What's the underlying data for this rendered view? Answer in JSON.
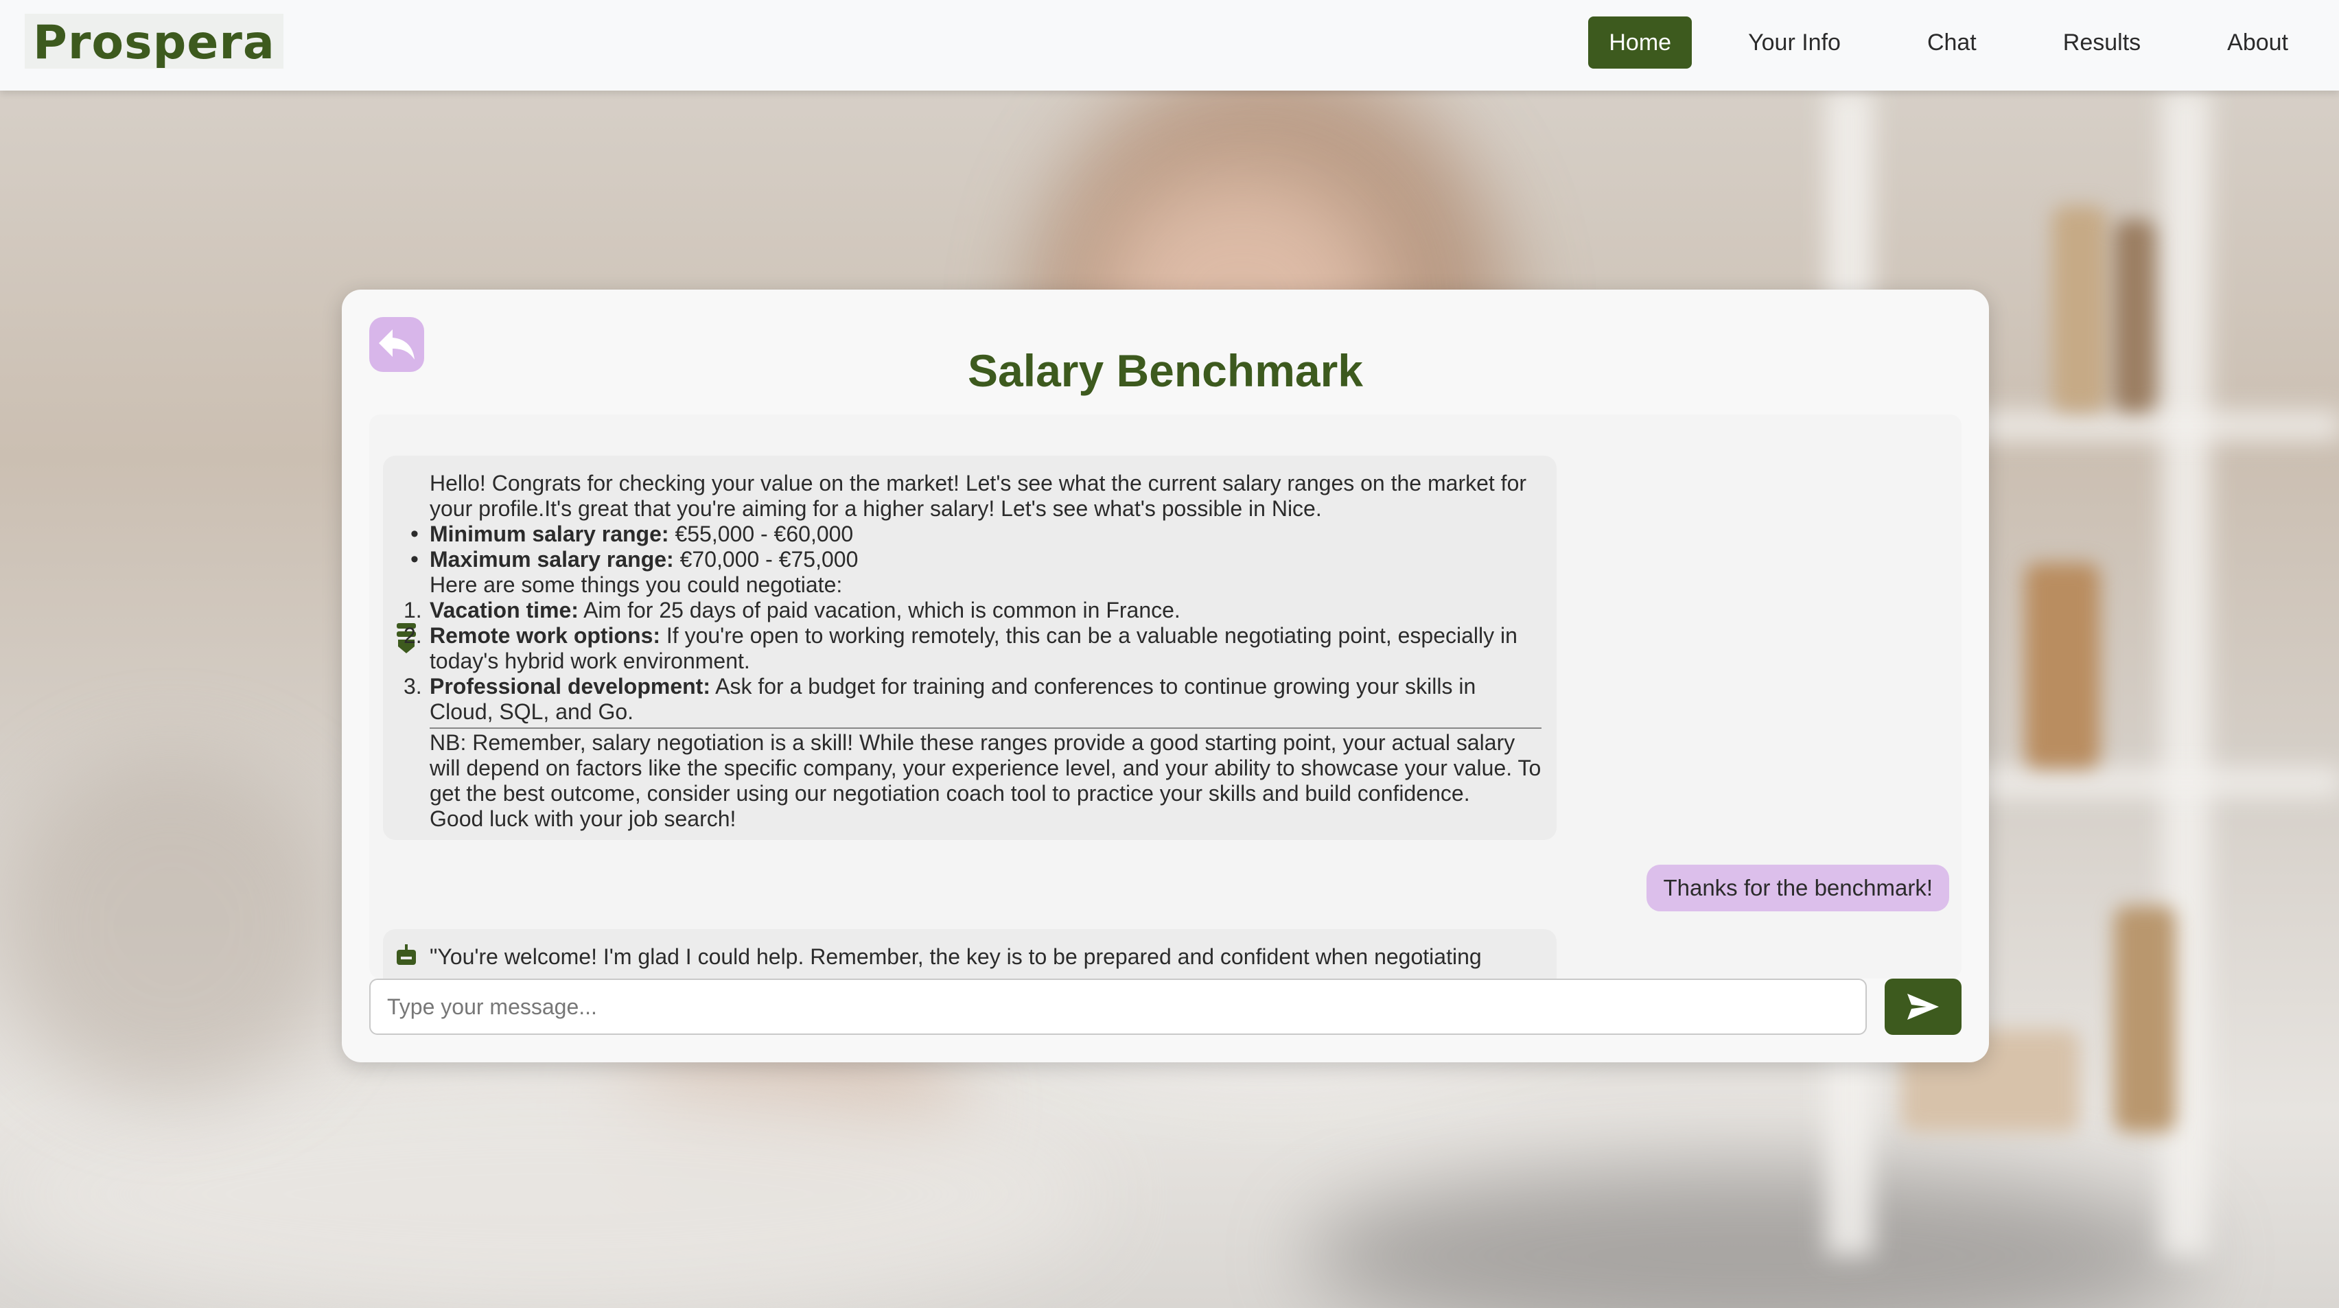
{
  "app": {
    "logo": "Prospera",
    "accent_color": "#3d5a1e",
    "secondary_color": "#dcbfeb"
  },
  "nav": {
    "items": [
      {
        "label": "Home",
        "active": true
      },
      {
        "label": "Your Info",
        "active": false
      },
      {
        "label": "Chat",
        "active": false
      },
      {
        "label": "Results",
        "active": false
      },
      {
        "label": "About",
        "active": false
      }
    ]
  },
  "card": {
    "title": "Salary Benchmark",
    "back_icon": "reply-arrow-icon"
  },
  "messages": {
    "bot1": {
      "intro": "Hello! Congrats for checking your value on the market! Let's see what the current salary ranges on the market for your profile.It's great that you're aiming for a higher salary! Let's see what's possible in Nice.",
      "bullets": [
        {
          "label": "Minimum salary range:",
          "value": " €55,000 - €60,000"
        },
        {
          "label": "Maximum salary range:",
          "value": " €70,000 - €75,000"
        }
      ],
      "negotiate_intro": "Here are some things you could negotiate:",
      "items": [
        {
          "num": "1.",
          "label": "Vacation time:",
          "text": " Aim for 25 days of paid vacation, which is common in France."
        },
        {
          "num": "2.",
          "label": "Remote work options:",
          "text": " If you're open to working remotely, this can be a valuable negotiating point, especially in today's hybrid work environment."
        },
        {
          "num": "3.",
          "label": "Professional development:",
          "text": " Ask for a budget for training and conferences to continue growing your skills in Cloud, SQL, and Go."
        }
      ],
      "note": "NB: Remember, salary negotiation is a skill! While these ranges provide a good starting point, your actual salary will depend on factors like the specific company, your experience level, and your ability to showcase your value. To get the best outcome, consider using our negotiation coach tool to practice your skills and build confidence.",
      "closing": "Good luck with your job search!"
    },
    "user1": "Thanks for the benchmark!",
    "bot2": "\"You're welcome! I'm glad I could help. Remember, the key is to be prepared and confident when negotiating"
  },
  "input": {
    "placeholder": "Type your message...",
    "value": "",
    "send_icon": "send-arrow-icon"
  }
}
